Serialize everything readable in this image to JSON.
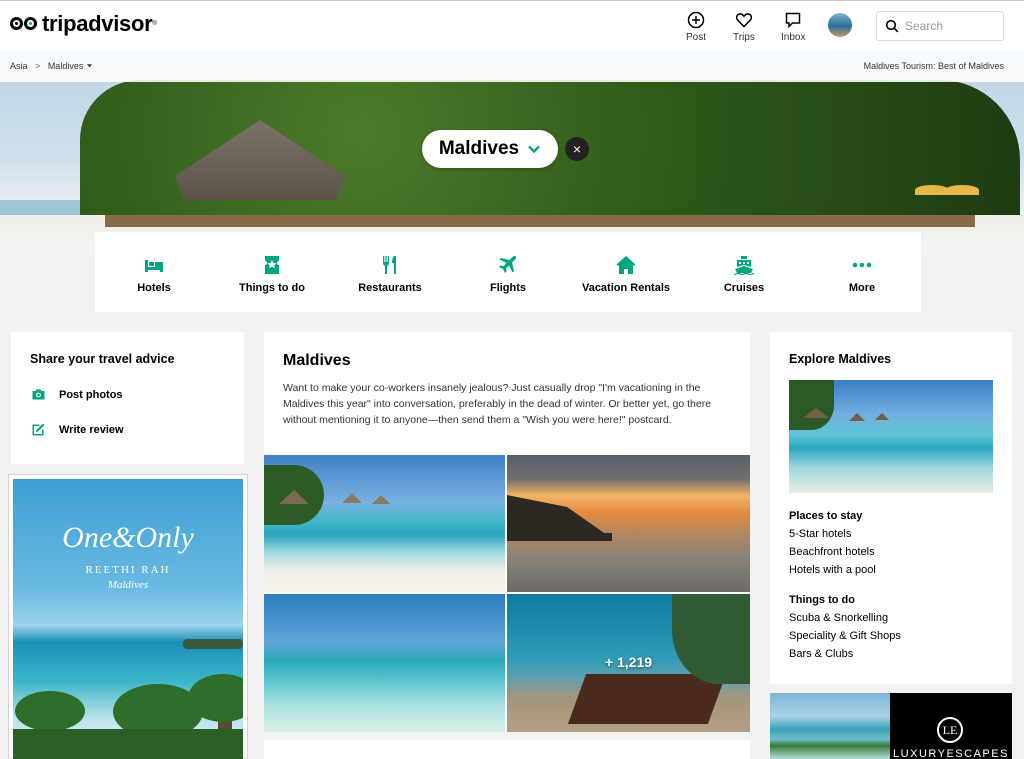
{
  "header": {
    "logo_text": "tripadvisor",
    "logo_tm": "®",
    "nav": [
      {
        "label": "Post",
        "icon": "plus-circle-icon"
      },
      {
        "label": "Trips",
        "icon": "heart-icon"
      },
      {
        "label": "Inbox",
        "icon": "chat-bubble-icon"
      }
    ],
    "search": {
      "placeholder": "Search",
      "value": ""
    }
  },
  "breadcrumb": {
    "items": [
      "Asia",
      "Maldives"
    ],
    "separator": ">",
    "right_link": "Maldives Tourism: Best of Maldives"
  },
  "destination": {
    "name": "Maldives",
    "close_symbol": "×"
  },
  "categories": [
    {
      "label": "Hotels",
      "icon": "bed-icon"
    },
    {
      "label": "Things to do",
      "icon": "ticket-icon"
    },
    {
      "label": "Restaurants",
      "icon": "fork-knife-icon"
    },
    {
      "label": "Flights",
      "icon": "airplane-icon"
    },
    {
      "label": "Vacation Rentals",
      "icon": "house-icon"
    },
    {
      "label": "Cruises",
      "icon": "ship-icon"
    },
    {
      "label": "More",
      "icon": "more-dots-icon"
    }
  ],
  "share": {
    "title": "Share your travel advice",
    "actions": [
      {
        "label": "Post photos",
        "icon": "camera-icon"
      },
      {
        "label": "Write review",
        "icon": "edit-icon"
      }
    ]
  },
  "left_ad": {
    "brand": "One&Only",
    "subtitle": "REETHI RAH",
    "location": "Maldives"
  },
  "overview": {
    "title": "Maldives",
    "description": "Want to make your co-workers insanely jealous? Just casually drop \"I'm vacationing in the Maldives this year\" into conversation, preferably in the dead of winter. Or better yet, go there without mentioning it to anyone—then send them a \"Wish you were here!\" postcard.",
    "photos_more": "+ 1,219"
  },
  "explore": {
    "title": "Explore Maldives",
    "sections": [
      {
        "heading": "Places to stay",
        "links": [
          "5-Star hotels",
          "Beachfront hotels",
          "Hotels with a pool"
        ]
      },
      {
        "heading": "Things to do",
        "links": [
          "Scuba & Snorkelling",
          "Speciality & Gift Shops",
          "Bars & Clubs"
        ]
      }
    ]
  },
  "right_ad": {
    "mark": "LE",
    "brand": "LUXURYESCAPES"
  },
  "colors": {
    "accent": "#00a680",
    "text": "#000000",
    "page_bg": "#f2f2f2"
  }
}
